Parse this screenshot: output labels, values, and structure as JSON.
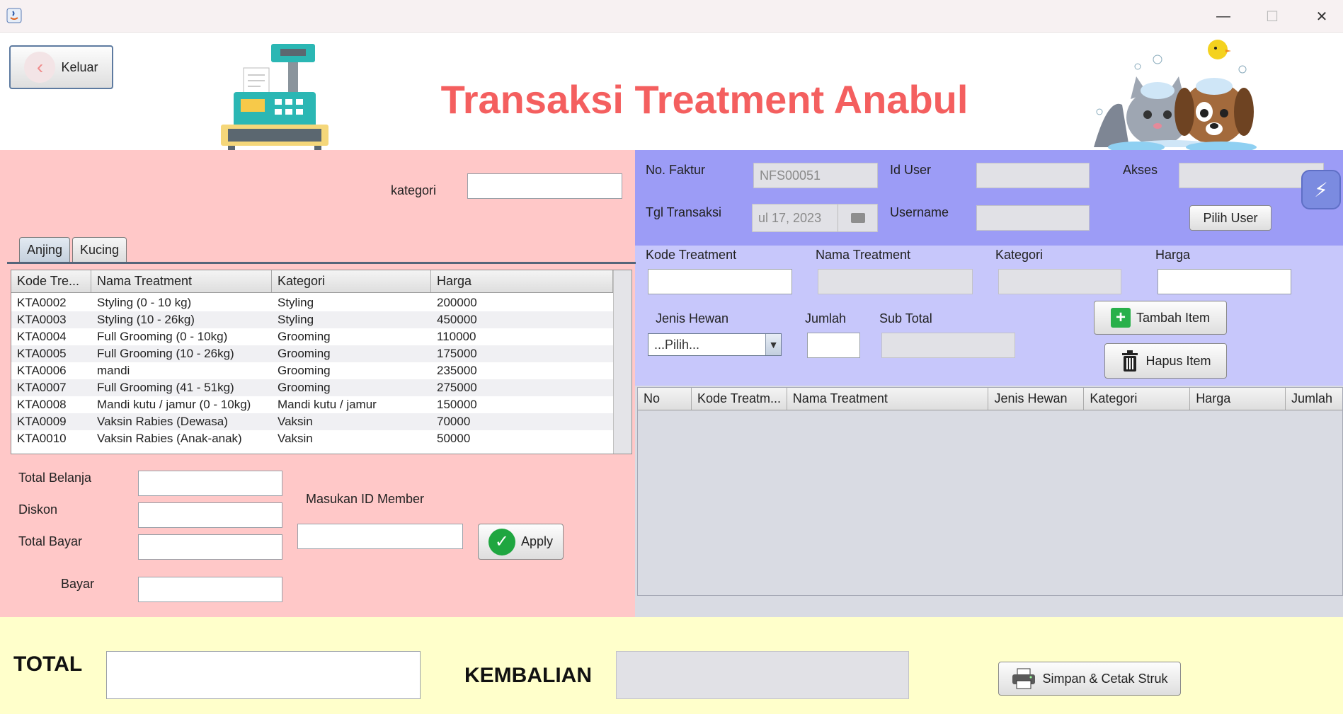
{
  "window": {
    "minimize": "—",
    "maximize": "☐",
    "close": "✕"
  },
  "header": {
    "back_label": "Keluar",
    "title": "Transaksi Treatment Anabul"
  },
  "left": {
    "kategori_label": "kategori",
    "kategori_value": "",
    "tabs": [
      {
        "label": "Anjing"
      },
      {
        "label": "Kucing"
      }
    ],
    "table": {
      "columns": [
        "Kode Tre...",
        "Nama Treatment",
        "Kategori",
        "Harga"
      ],
      "rows": [
        [
          "KTA0002",
          "Styling (0 - 10 kg)",
          "Styling",
          "200000"
        ],
        [
          "KTA0003",
          "Styling (10 - 26kg)",
          "Styling",
          "450000"
        ],
        [
          "KTA0004",
          "Full Grooming (0 - 10kg)",
          "Grooming",
          "110000"
        ],
        [
          "KTA0005",
          "Full Grooming (10 - 26kg)",
          "Grooming",
          "175000"
        ],
        [
          "KTA0006",
          "mandi",
          "Grooming",
          "235000"
        ],
        [
          "KTA0007",
          "Full Grooming (41 - 51kg)",
          "Grooming",
          "275000"
        ],
        [
          "KTA0008",
          "Mandi kutu / jamur (0 - 10kg)",
          "Mandi kutu / jamur",
          "150000"
        ],
        [
          "KTA0009",
          "Vaksin Rabies (Dewasa)",
          "Vaksin",
          "70000"
        ],
        [
          "KTA0010",
          "Vaksin Rabies (Anak-anak)",
          "Vaksin",
          "50000"
        ]
      ]
    },
    "total_belanja_label": "Total Belanja",
    "diskon_label": "Diskon",
    "total_bayar_label": "Total Bayar",
    "bayar_label": "Bayar",
    "member_label": "Masukan ID Member",
    "apply_label": "Apply"
  },
  "right": {
    "no_faktur_label": "No. Faktur",
    "no_faktur_value": "NFS00051",
    "id_user_label": "Id User",
    "akses_label": "Akses",
    "tgl_label": "Tgl Transaksi",
    "tgl_value": "ul 17, 2023",
    "username_label": "Username",
    "pilih_user_label": "Pilih User",
    "kode_treatment_label": "Kode Treatment",
    "nama_treatment_label": "Nama Treatment",
    "kategori_label": "Kategori",
    "harga_label": "Harga",
    "jenis_hewan_label": "Jenis Hewan",
    "jenis_hewan_value": "...Pilih...",
    "jumlah_label": "Jumlah",
    "subtotal_label": "Sub Total",
    "tambah_label": "Tambah Item",
    "hapus_label": "Hapus Item",
    "cart_columns": [
      "No",
      "Kode Treatm...",
      "Nama Treatment",
      "Jenis Hewan",
      "Kategori",
      "Harga",
      "Jumlah"
    ]
  },
  "footer": {
    "total_label": "TOTAL",
    "kembalian_label": "KEMBALIAN",
    "simpan_label": "Simpan & Cetak Struk"
  }
}
